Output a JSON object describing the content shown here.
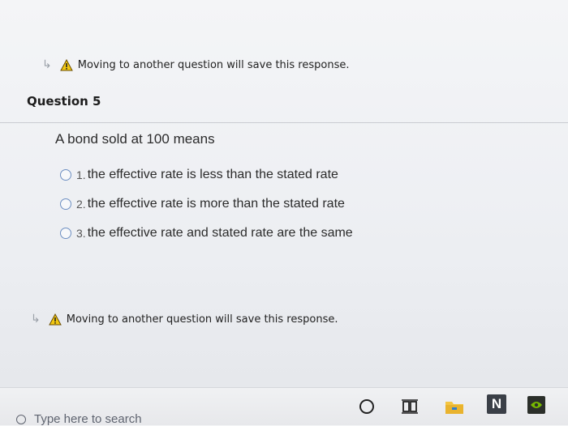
{
  "warnings": {
    "top": "Moving to another question will save this response.",
    "bottom": "Moving to another question will save this response."
  },
  "question": {
    "title": "Question 5",
    "text": "A bond sold at 100 means",
    "options": [
      {
        "num": "1.",
        "label": "the effective rate is less than the stated rate"
      },
      {
        "num": "2.",
        "label": "the effective rate is more than the stated rate"
      },
      {
        "num": "3.",
        "label": "the effective rate and stated rate are the same"
      }
    ]
  },
  "taskbar": {
    "search_placeholder": "Type here to search",
    "app_z_label": "N"
  },
  "colors": {
    "warning_yellow": "#f2c811",
    "radio_border": "#6d8fc2",
    "nvidia_green": "#76b900"
  }
}
